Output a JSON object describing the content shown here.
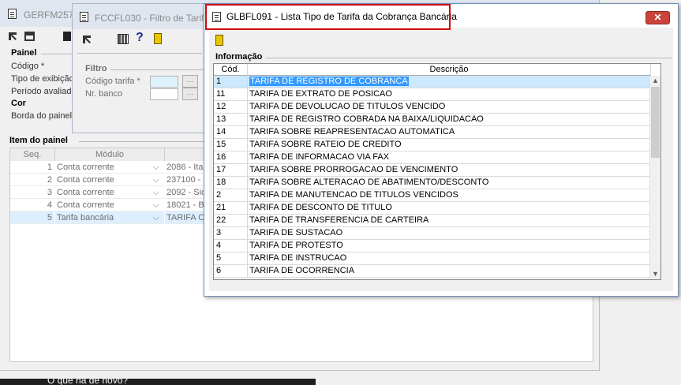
{
  "background_window": {
    "title": "GERFM257 -",
    "sections": {
      "painel": "Painel",
      "cor": "Cor",
      "item": "Item do painel"
    },
    "labels": {
      "codigo": "Código *",
      "tipo": "Tipo de exibição",
      "periodo": "Período avaliado",
      "borda": "Borda do painel"
    },
    "grid": {
      "headers": [
        "Seq.",
        "Módulo"
      ],
      "rows": [
        {
          "seq": "1",
          "modulo": "Conta corrente",
          "extra": "2086 - Ita"
        },
        {
          "seq": "2",
          "modulo": "Conta corrente",
          "extra": "237100 -"
        },
        {
          "seq": "3",
          "modulo": "Conta corrente",
          "extra": "2092 - Sic"
        },
        {
          "seq": "4",
          "modulo": "Conta corrente",
          "extra": "18021 - B"
        },
        {
          "seq": "5",
          "modulo": "Tarifa bancária",
          "extra": "TARIFA CE"
        }
      ]
    }
  },
  "filter_window": {
    "title": "FCCFL030 - Filtro de Tarifa",
    "section": "Filtro",
    "labels": {
      "codigo_tarifa": "Código tarifa *",
      "nr_banco": "Nr. banco"
    }
  },
  "dialog": {
    "title": "GLBFL091 - Lista Tipo de Tarifa da Cobrança Bancária",
    "close_label": "✕",
    "section_label": "Informação",
    "columns": {
      "cod": "Cód.",
      "descricao": "Descrição"
    },
    "rows": [
      {
        "cod": "1",
        "descricao": "TARIFA DE REGISTRO DE COBRANCA"
      },
      {
        "cod": "11",
        "descricao": "TARIFA DE EXTRATO DE POSICAO"
      },
      {
        "cod": "12",
        "descricao": "TARIFA DE DEVOLUCAO DE TITULOS VENCIDO"
      },
      {
        "cod": "13",
        "descricao": "TARIFA DE REGISTRO COBRADA NA BAIXA/LIQUIDACAO"
      },
      {
        "cod": "14",
        "descricao": "TARIFA SOBRE REAPRESENTACAO AUTOMATICA"
      },
      {
        "cod": "15",
        "descricao": "TARIFA SOBRE RATEIO DE CREDITO"
      },
      {
        "cod": "16",
        "descricao": "TARIFA DE INFORMACAO VIA FAX"
      },
      {
        "cod": "17",
        "descricao": "TARIFA SOBRE PRORROGACAO DE VENCIMENTO"
      },
      {
        "cod": "18",
        "descricao": "TARIFA SOBRE ALTERACAO DE ABATIMENTO/DESCONTO"
      },
      {
        "cod": "2",
        "descricao": "TARIFA DE MANUTENCAO DE TITULOS VENCIDOS"
      },
      {
        "cod": "21",
        "descricao": "TARIFA DE DESCONTO DE TITULO"
      },
      {
        "cod": "22",
        "descricao": "TARIFA DE TRANSFERENCIA DE CARTEIRA"
      },
      {
        "cod": "3",
        "descricao": "TARIFA DE SUSTACAO"
      },
      {
        "cod": "4",
        "descricao": "TARIFA DE PROTESTO"
      },
      {
        "cod": "5",
        "descricao": "TARIFA DE INSTRUCAO"
      },
      {
        "cod": "6",
        "descricao": "TARIFA DE OCORRENCIA"
      }
    ],
    "selected_index": 0
  },
  "taskbar_text": "O que há de novo?",
  "colors": {
    "selection": "#3399ff",
    "selected_row": "#cce8ff",
    "highlight_box": "#d20a0a",
    "close_button": "#c9433b"
  }
}
